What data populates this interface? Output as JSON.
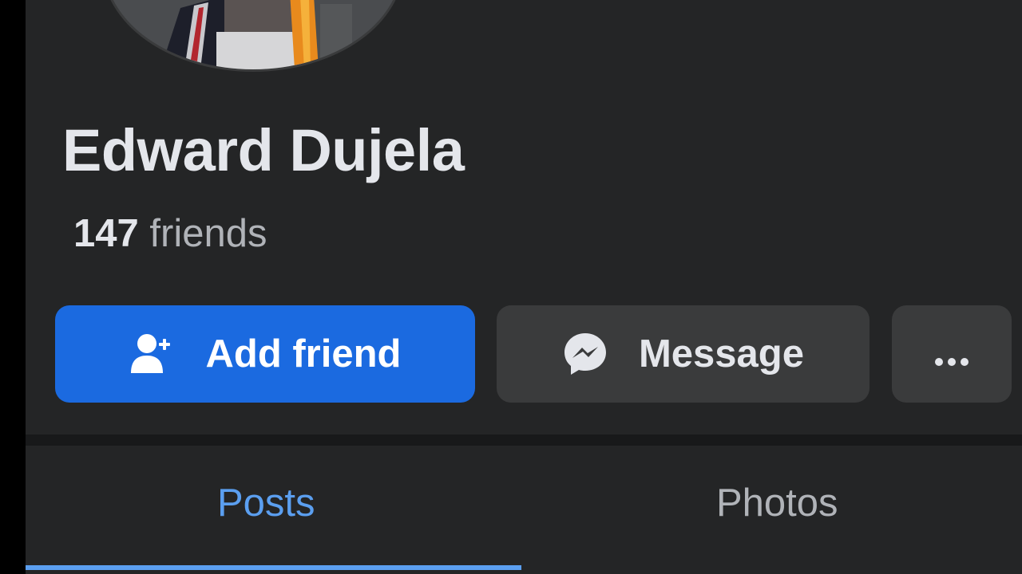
{
  "profile": {
    "name": "Edward Dujela",
    "friends_count": "147",
    "friends_label": "friends"
  },
  "actions": {
    "add_friend_label": "Add friend",
    "message_label": "Message",
    "more_icon": "more-horizontal-icon"
  },
  "tabs": [
    {
      "label": "Posts",
      "active": true
    },
    {
      "label": "Photos",
      "active": false
    }
  ],
  "colors": {
    "background": "#242526",
    "primary_button": "#1b6ae0",
    "secondary_button": "#3a3b3c",
    "active_tab": "#5b9ff0",
    "text_primary": "#e4e6eb",
    "text_secondary": "#b0b3b8"
  }
}
